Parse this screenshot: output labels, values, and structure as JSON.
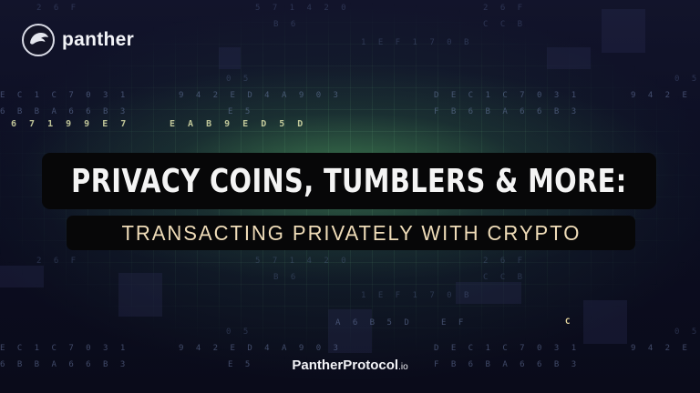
{
  "brand": {
    "name": "panther",
    "logo_icon": "panther-logo-icon"
  },
  "headline": "PRIVACY COINS, TUMBLERS & MORE:",
  "subheadline": "TRANSACTING PRIVATELY WITH CRYPTO",
  "footer": {
    "domain": "PantherProtocol",
    "tld": ".io"
  },
  "background_code": [
    "2 6 F",
    "5 7 1 4 2 0",
    "2 6 F",
    "B 6",
    "C C B",
    "1 E F 1 7 0 B",
    "0 5",
    "0 5",
    "E C 1 C 7 0 3 1",
    "9 4 2 E D 4 A 9 0 3",
    "D E C 1 C 7 0 3 1",
    "9 4 2 E",
    "6 B B A 6 6 B 3",
    "E 5",
    "F B 6 B A 6 6 B 3",
    "6 7 1 9 9 E 7",
    "E A B 9 E D 5 D",
    "2 6 F",
    "5 7 1 4 2 0",
    "A 6 B 5 D",
    "E F",
    "C"
  ],
  "colors": {
    "background": "#0b0c1c",
    "glow": "#468c55",
    "headline_text": "#f4f4f4",
    "subhead_text": "#efdcb8",
    "label_box": "#070708"
  }
}
